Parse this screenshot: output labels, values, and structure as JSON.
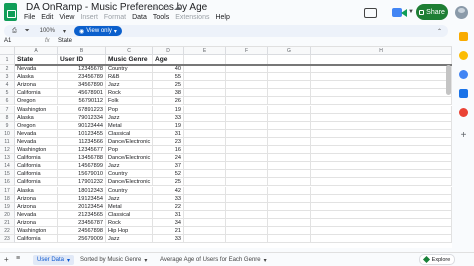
{
  "app": {
    "doc_title": "DA OnRamp - Music Preferences by Age",
    "menu": [
      "File",
      "Edit",
      "View",
      "Insert",
      "Format",
      "Data",
      "Tools",
      "Extensions",
      "Help"
    ],
    "share_label": "Share"
  },
  "toolbar": {
    "zoom": "100%",
    "view_only_label": "View only"
  },
  "formula_bar": {
    "cell_ref": "A1",
    "fx": "fx",
    "value": "State"
  },
  "sheet": {
    "columns": [
      "A",
      "B",
      "C",
      "D",
      "E",
      "F",
      "G",
      "H"
    ],
    "header_row": [
      "State",
      "User ID",
      "Music Genre",
      "Age"
    ],
    "rows": [
      [
        "Nevada",
        "12345678",
        "Country",
        "40"
      ],
      [
        "Alaska",
        "23456789",
        "R&B",
        "55"
      ],
      [
        "Arizona",
        "34567890",
        "Jazz",
        "25"
      ],
      [
        "California",
        "45678901",
        "Rock",
        "38"
      ],
      [
        "Oregon",
        "56790112",
        "Folk",
        "26"
      ],
      [
        "Washington",
        "67891223",
        "Pop",
        "19"
      ],
      [
        "Alaska",
        "79012334",
        "Jazz",
        "33"
      ],
      [
        "Oregon",
        "90123444",
        "Metal",
        "19"
      ],
      [
        "Nevada",
        "10123455",
        "Classical",
        "31"
      ],
      [
        "Nevada",
        "11234566",
        "Dance/Electronic",
        "23"
      ],
      [
        "Washington",
        "12345677",
        "Pop",
        "16"
      ],
      [
        "California",
        "13456788",
        "Dance/Electronic",
        "24"
      ],
      [
        "California",
        "14567899",
        "Jazz",
        "37"
      ],
      [
        "California",
        "15679010",
        "Country",
        "52"
      ],
      [
        "California",
        "17901232",
        "Dance/Electronic",
        "25"
      ],
      [
        "Alaska",
        "18012343",
        "Country",
        "42"
      ],
      [
        "Arizona",
        "19123454",
        "Jazz",
        "33"
      ],
      [
        "Arizona",
        "20123454",
        "Metal",
        "22"
      ],
      [
        "Nevada",
        "21234565",
        "Classical",
        "31"
      ],
      [
        "Arizona",
        "23456787",
        "Rock",
        "34"
      ],
      [
        "Washington",
        "24567898",
        "Hip Hop",
        "21"
      ],
      [
        "California",
        "25679009",
        "Jazz",
        "33"
      ]
    ]
  },
  "tabs": [
    {
      "label": "User Data",
      "active": true
    },
    {
      "label": "Sorted by Music Genre",
      "active": false
    },
    {
      "label": "Average Age of Users for Each Genre",
      "active": false
    }
  ],
  "explore_label": "Explore",
  "colors": {
    "share_bg": "#1e7e34",
    "view_only_bg": "#0b5fcc",
    "active_tab": "#0b57d0"
  }
}
